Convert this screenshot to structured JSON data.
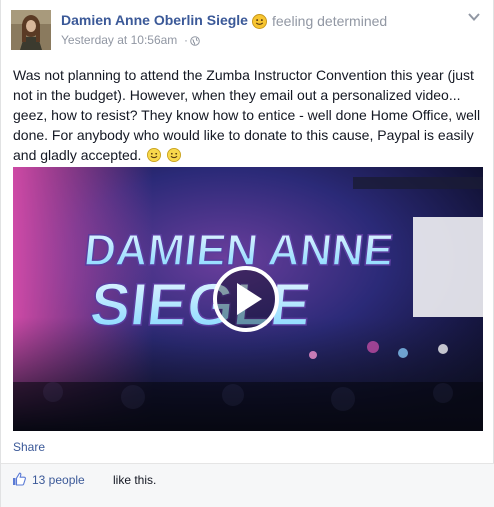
{
  "post": {
    "author_name": "Damien Anne Oberlin Siegle",
    "feeling_text": "feeling determined",
    "timestamp": "Yesterday at 10:56am",
    "timestamp_separator": "·",
    "body_text": "Was not planning to attend the Zumba Instructor Convention this year (just not in the budget). However, when they email out a personalized video... geez, how to resist? They know how to entice - well done Home Office, well done. For anybody who would like to donate to this cause, Paypal is easily and gladly accepted.",
    "body_emoticons": [
      "smile-emoticon",
      "smile-emoticon"
    ],
    "video": {
      "title_line1": "DAMIEN ANNE",
      "title_line2": "SIEGLE",
      "play_icon": "play-icon"
    },
    "share_label": "Share",
    "likes_count_label": "13 people",
    "likes_suffix": "like this.",
    "icons": {
      "feeling": "smiley-icon",
      "privacy": "globe-icon",
      "menu": "chevron-down-icon",
      "like": "thumbs-up-icon"
    },
    "colors": {
      "link": "#3b5998",
      "meta": "#9197a3",
      "text": "#141823"
    }
  }
}
